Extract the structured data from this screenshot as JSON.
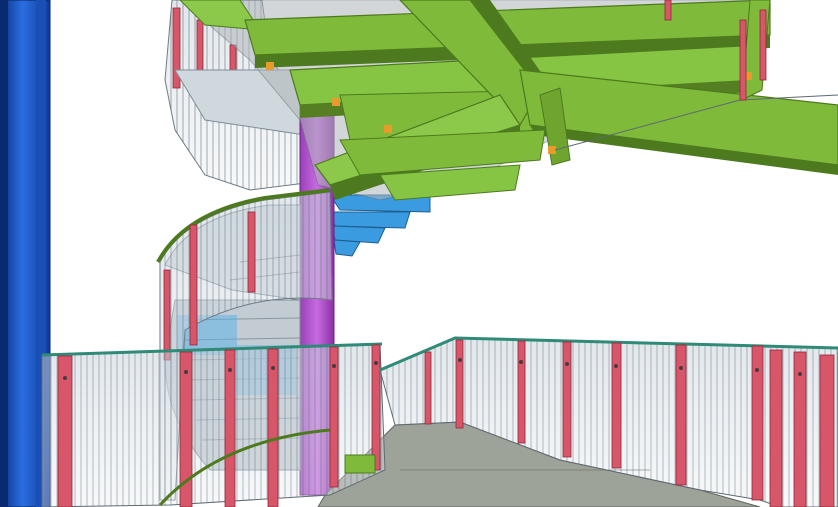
{
  "scene": {
    "description_visible_text": "",
    "colors": {
      "background": "#ffffff",
      "column_blue": "#1f5fd0",
      "column_blue_dark": "#0b2f86",
      "pillar_purple": "#b24fd0",
      "pillar_purple_dark": "#7a2a96",
      "beam_green": "#7fba3a",
      "beam_green_dark": "#4d7a1e",
      "beam_green_light": "#a6d46a",
      "post_red": "#d7566a",
      "post_red_dark": "#8e2a3a",
      "glass": "#9fb0bf",
      "tread_blue": "#3a9be0",
      "landing_grey": "#9ea39a",
      "stair_grey": "#b8c2c8",
      "rail_teal": "#2f8a78"
    }
  }
}
